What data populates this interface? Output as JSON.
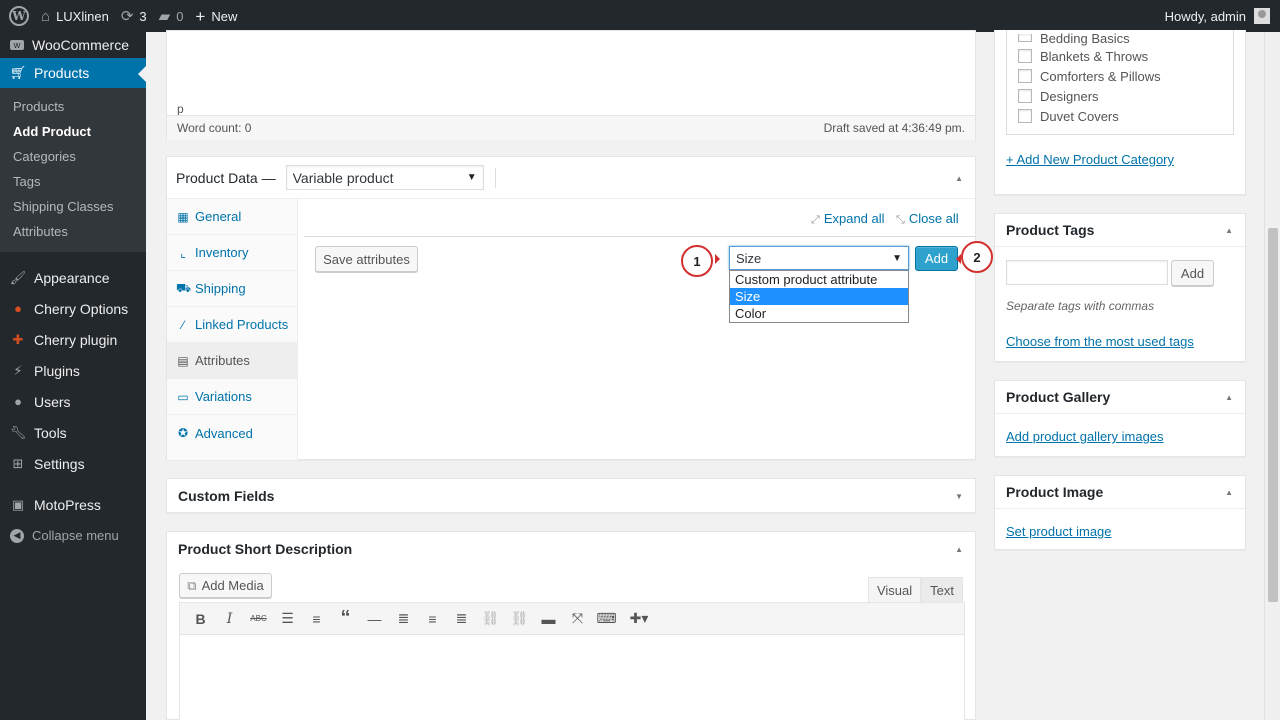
{
  "adminbar": {
    "site_name": "LUXlinen",
    "updates_count": "3",
    "comments_count": "0",
    "new_label": "New",
    "howdy": "Howdy, admin"
  },
  "sidebar": {
    "woocommerce": "WooCommerce",
    "products": "Products",
    "submenu": [
      "Products",
      "Add Product",
      "Categories",
      "Tags",
      "Shipping Classes",
      "Attributes"
    ],
    "appearance": "Appearance",
    "cherry_options": "Cherry Options",
    "cherry_plugin": "Cherry plugin",
    "plugins": "Plugins",
    "users": "Users",
    "tools": "Tools",
    "settings": "Settings",
    "motopress": "MotoPress",
    "collapse": "Collapse menu"
  },
  "editor": {
    "path": "p",
    "word_count": "Word count: 0",
    "draft_saved": "Draft saved at 4:36:49 pm."
  },
  "product_data": {
    "title": "Product Data —",
    "type_value": "Variable product",
    "tabs": [
      "General",
      "Inventory",
      "Shipping",
      "Linked Products",
      "Attributes",
      "Variations",
      "Advanced"
    ],
    "expand_all": "Expand all",
    "close_all": "Close all",
    "save_attributes": "Save attributes",
    "attribute_select": "Size",
    "dropdown_options": [
      "Custom product attribute",
      "Size",
      "Color"
    ],
    "add_button": "Add",
    "callout_1": "1",
    "callout_2": "2"
  },
  "custom_fields": {
    "title": "Custom Fields"
  },
  "short_description": {
    "title": "Product Short Description",
    "add_media": "Add Media",
    "visual": "Visual",
    "text": "Text"
  },
  "categories": {
    "items": [
      "Bedding Basics",
      "Blankets & Throws",
      "Comforters & Pillows",
      "Designers",
      "Duvet Covers"
    ],
    "add_new": "+ Add New Product Category"
  },
  "tags": {
    "title": "Product Tags",
    "add_button": "Add",
    "hint": "Separate tags with commas",
    "most_used": "Choose from the most used tags"
  },
  "gallery": {
    "title": "Product Gallery",
    "link": "Add product gallery images"
  },
  "image": {
    "title": "Product Image",
    "link": "Set product image"
  },
  "colors": {
    "accent": "#0073aa",
    "admin_bg": "#23282d",
    "primary_button": "#2ea2cc",
    "callout_red": "#d32f2f"
  }
}
